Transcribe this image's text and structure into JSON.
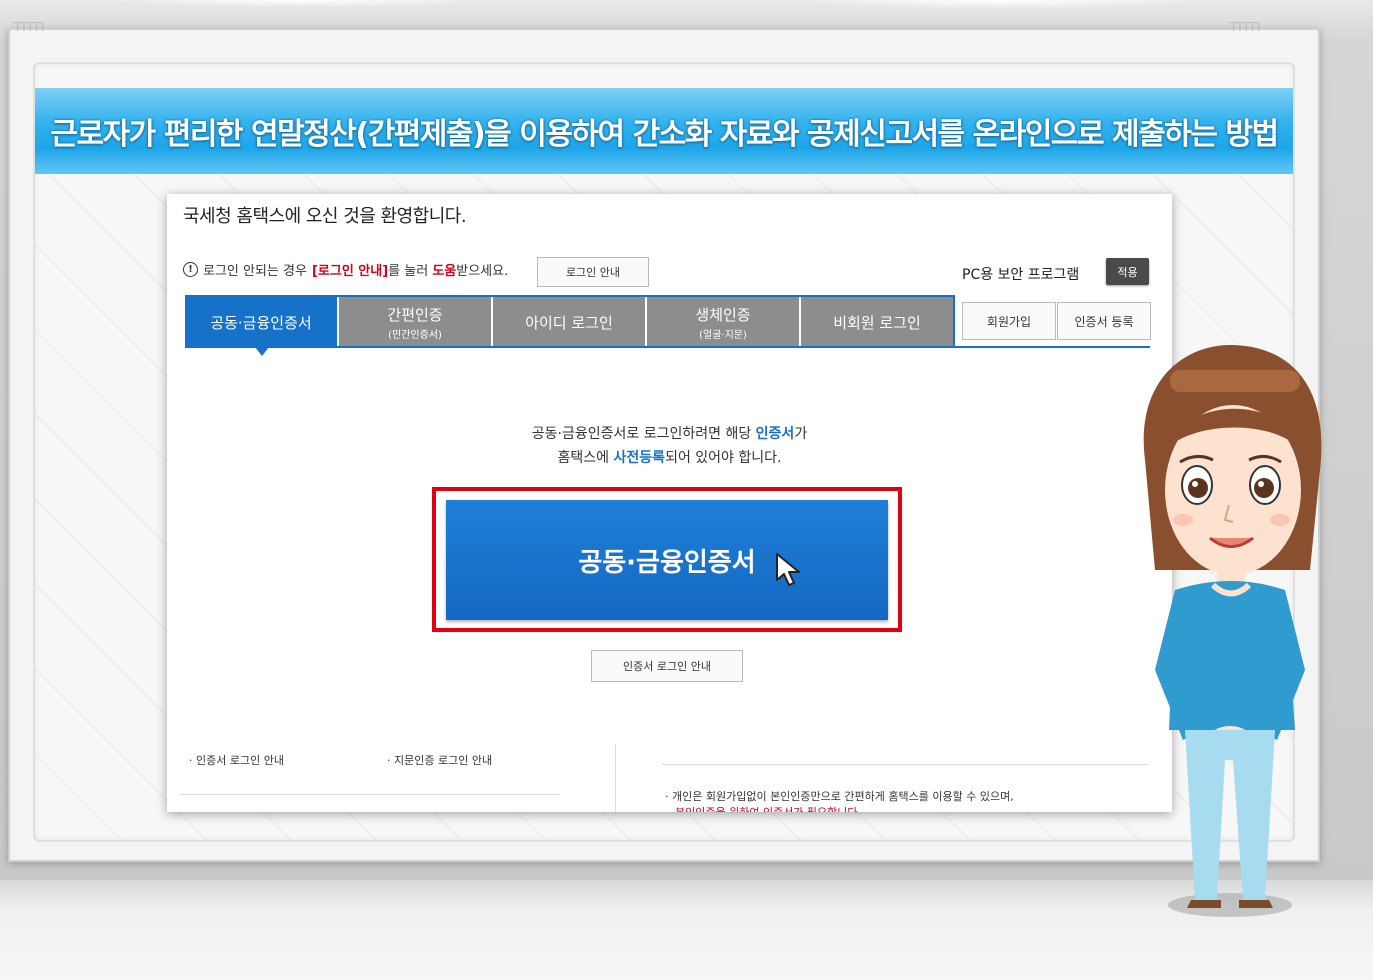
{
  "banner": {
    "title": "근로자가 편리한 연말정산(간편제출)을 이용하여 간소화 자료와 공제신고서를 온라인으로 제출하는 방법"
  },
  "decor": {
    "greek_left": "ᒣᒣᒣᒣᒣ",
    "greek_right": "ᒣᒣᒣᒣᒣ"
  },
  "welcome": "국세청 홈택스에 오신 것을 환영합니다.",
  "notice": {
    "prefix": "로그인 안되는 경우",
    "link": "[로그인 안내]",
    "middle": "를 눌러",
    "help": "도움",
    "suffix": "받으세요."
  },
  "login_guide_button": "로그인 안내",
  "pc_security": {
    "label": "PC용 보안 프로그램",
    "apply": "적용"
  },
  "tabs": [
    {
      "label": "공동·금융인증서",
      "sub": ""
    },
    {
      "label": "간편인증",
      "sub": "(민간인증서)"
    },
    {
      "label": "아이디 로그인",
      "sub": ""
    },
    {
      "label": "생체인증",
      "sub": "(얼굴·지문)"
    },
    {
      "label": "비회원 로그인",
      "sub": ""
    }
  ],
  "side_buttons": {
    "signup": "회원가입",
    "cert_register": "인증서 등록"
  },
  "description": {
    "line1_a": "공동·금융인증서로 로그인하려면 해당",
    "line1_b": "인증서",
    "line1_c": "가",
    "line2_a": "홈택스에",
    "line2_b": "사전등록",
    "line2_c": "되어 있어야 합니다."
  },
  "main_button": "공동·금융인증서",
  "cert_login_guide": "인증서 로그인 안내",
  "footer": {
    "item1": "· 인증서 로그인 안내",
    "item2": "· 지문인증 로그인 안내",
    "note1": "· 개인은 회원가입없이 본인인증만으로 간편하게 홈택스를 이용할 수 있으며,",
    "note2": "본인인증을 위하여 인증서가 필요합니다."
  },
  "colors": {
    "accent": "#1672c9",
    "highlight": "#e00010",
    "banner": "#1ea6ea"
  }
}
